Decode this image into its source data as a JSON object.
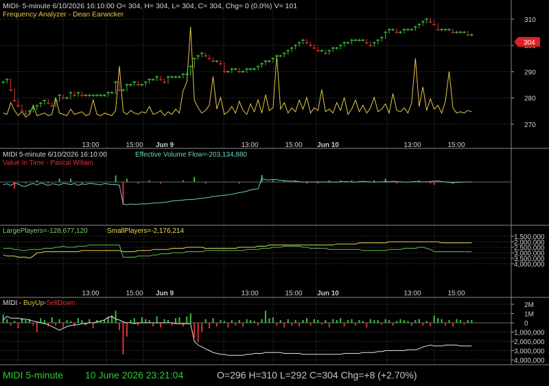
{
  "colors": {
    "background": "#000000",
    "grid": "#4a4a4a",
    "axis_text": "#d0d0d0",
    "up": "#3cc43c",
    "down": "#e03030",
    "yellow": "#e8c84a",
    "cyan": "#6fd0c8",
    "orange": "#d87020",
    "footer_green": "#2fd02f"
  },
  "panels": {
    "price": {
      "header": "MIDI- 5-minute 6/10/2026 16:10:00 O= 304, H= 304, L= 304, C= 304, Chg= 0 (0.0%) V= 101",
      "subtitle": "Frequency Analyzer - Dean Earwicker",
      "last_price_tag": "304"
    },
    "evf": {
      "header": "MIDI 5-minute  6/10/2026 16:10:00",
      "indicator": "Effective Volume Flow=-203,134,880",
      "subtitle": "Value In Time - Pascal Willain"
    },
    "players": {
      "large_label": "LargePlayers=-128,677,120",
      "small_label": "SmallPlayers=-2,176,214"
    },
    "buyup": {
      "prefix": "MIDI - ",
      "buy": "BuyUp",
      "sep": "-",
      "sell": "SellDown"
    }
  },
  "x_axis": {
    "labels": [
      {
        "text": "13:00",
        "bold": false
      },
      {
        "text": "15:00",
        "bold": false
      },
      {
        "text": "Jun 9",
        "bold": true
      },
      {
        "text": "13:00",
        "bold": false
      },
      {
        "text": "15:00",
        "bold": false
      },
      {
        "text": "Jun 10",
        "bold": true
      },
      {
        "text": "13:00",
        "bold": false
      },
      {
        "text": "15:00",
        "bold": false
      }
    ]
  },
  "footer": {
    "symbol": "MIDI  5-minute",
    "date": "10 June 2026 23:21:04",
    "ohlc": "O=296  H=310  L=292  C=304  Chg=+8 (+2.70%)"
  },
  "chart_data": [
    {
      "type": "line",
      "title": "MIDI- 5-minute",
      "y_axis_ticks": [
        270,
        280,
        290,
        300,
        310
      ],
      "ylim": [
        265,
        316
      ],
      "series": [
        {
          "name": "MIDI price",
          "values": [
            286,
            287,
            283,
            279,
            277,
            275,
            274,
            275,
            276,
            277,
            278,
            279,
            278,
            277,
            279,
            281,
            280,
            280,
            282,
            281,
            282,
            281,
            281,
            281,
            281,
            281,
            281,
            281,
            282,
            282,
            286,
            283,
            283,
            285,
            285,
            286,
            285,
            285,
            286,
            287,
            287,
            288,
            287,
            286,
            288,
            288,
            288,
            288,
            289,
            289,
            292,
            295,
            296,
            297,
            296,
            295,
            294,
            294,
            293,
            290,
            290,
            291,
            291,
            290,
            290,
            291,
            291,
            291,
            292,
            293,
            294,
            294,
            295,
            296,
            296,
            297,
            298,
            299,
            300,
            301,
            302,
            301,
            300,
            299,
            298,
            298,
            297,
            298,
            299,
            299,
            300,
            301,
            301,
            302,
            302,
            302,
            302,
            301,
            300,
            301,
            302,
            303,
            305,
            306,
            306,
            305,
            305,
            306,
            306,
            306,
            307,
            308,
            309,
            310,
            309,
            308,
            306,
            306,
            306,
            306,
            305,
            305,
            305,
            305,
            304,
            304
          ]
        }
      ]
    },
    {
      "type": "line",
      "title": "Frequency Analyzer - Dean Earwicker",
      "series": [
        {
          "name": "Frequency Analyzer",
          "values": [
            0.6,
            0.5,
            1.4,
            0.8,
            0.4,
            0.7,
            0.3,
            0.5,
            1.2,
            0.4,
            0.5,
            0.6,
            0.4,
            0.5,
            1.8,
            0.6,
            0.5,
            0.4,
            0.9,
            0.5,
            0.6,
            0.7,
            0.4,
            0.5,
            1.6,
            0.5,
            0.4,
            0.6,
            0.5,
            0.4,
            0.8,
            4.2,
            0.7,
            0.5,
            0.8,
            0.6,
            0.5,
            0.7,
            0.6,
            1.1,
            0.5,
            0.6,
            0.8,
            0.4,
            0.7,
            0.5,
            0.9,
            0.6,
            2.3,
            3.0,
            7.2,
            1.6,
            1.0,
            0.6,
            0.8,
            1.2,
            3.4,
            0.9,
            1.8,
            0.5,
            0.7,
            1.1,
            0.6,
            1.5,
            0.8,
            0.5,
            1.3,
            0.7,
            1.6,
            0.6,
            2.0,
            0.8,
            1.0,
            5.0,
            0.9,
            1.4,
            0.6,
            1.0,
            0.7,
            1.6,
            0.9,
            1.8,
            0.6,
            1.0,
            0.8,
            2.4,
            0.7,
            0.9,
            0.6,
            1.4,
            0.8,
            1.8,
            0.5,
            0.9,
            1.6,
            0.7,
            1.2,
            0.6,
            1.0,
            1.8,
            0.7,
            0.9,
            1.3,
            0.6,
            2.1,
            0.8,
            0.7,
            1.0,
            0.6,
            1.4,
            4.8,
            1.1,
            2.6,
            0.8,
            1.7,
            0.9,
            1.2,
            0.6,
            1.5,
            3.8,
            1.0,
            0.6,
            0.7,
            0.6,
            0.8,
            0.7
          ]
        }
      ]
    },
    {
      "type": "bar",
      "title": "Effective Volume Flow",
      "series": [
        {
          "name": "Effective Volume Flow",
          "values": [
            -1.2,
            -0.8,
            -1.5,
            -0.6,
            -0.9,
            -1.8,
            -2.0,
            -1.1,
            -0.7,
            -1.3,
            -0.5,
            -0.9,
            -1.6,
            -0.8,
            -1.0,
            -1.4,
            -0.6,
            -0.8,
            -1.2,
            -0.7,
            -1.5,
            -0.9,
            -1.1,
            -0.6,
            -0.8,
            -1.0,
            -1.3,
            -0.7,
            -0.9,
            -1.2,
            -1.1,
            -1.4,
            -10.1,
            -10.3,
            -10.0,
            -10.2,
            -10.1,
            -9.9,
            -10.0,
            -9.8,
            -9.6,
            -9.5,
            -9.4,
            -9.3,
            -9.0,
            -8.7,
            -8.5,
            -8.4,
            -8.2,
            -8.0,
            -8.0,
            -7.9,
            -7.6,
            -7.4,
            -7.2,
            -7.0,
            -6.6,
            -6.4,
            -6.2,
            -6.0,
            -5.8,
            -5.6,
            -5.2,
            -4.8,
            -4.6,
            -4.2,
            -3.6,
            -3.3,
            -3.1,
            1.6,
            1.0,
            0.9,
            1.2,
            1.0,
            0.8,
            0.6,
            0.5,
            0.3,
            0.4,
            0.2,
            -0.1,
            0.1,
            0.0,
            -0.1,
            0.1,
            0.0,
            0.1,
            -0.1,
            0.0,
            -0.1,
            0.1,
            0.2,
            0.1,
            0.0,
            -0.1,
            0.2,
            0.3,
            0.2,
            0.1,
            -0.1,
            0.0,
            0.1,
            0.2,
            0.1,
            0.3,
            0.2,
            0.1,
            0.0,
            -0.1,
            0.1,
            0.2,
            0.1,
            0.0,
            0.1,
            0.2,
            0.4,
            0.5,
            0.2,
            0.0,
            -0.2,
            -0.4,
            -0.2,
            -0.1,
            0.0,
            0.0,
            0.0
          ]
        }
      ]
    },
    {
      "type": "line",
      "title": "LargePlayers / SmallPlayers",
      "y_axis_ticks": [
        "1,500,000",
        "2,000,000",
        "2,500,000",
        "3,000,000",
        "3,500,000",
        "4,000,000"
      ],
      "series": [
        {
          "name": "LargePlayers",
          "values": [
            2.6,
            2.6,
            2.6,
            2.7,
            2.7,
            2.8,
            2.8,
            2.7,
            2.7,
            2.7,
            2.7,
            2.6,
            2.6,
            2.6,
            2.5,
            2.5,
            2.4,
            2.5,
            2.5,
            2.5,
            2.4,
            2.4,
            2.4,
            2.3,
            2.3,
            2.3,
            2.3,
            2.3,
            2.3,
            2.3,
            2.3,
            2.3,
            3.4,
            3.4,
            3.4,
            3.4,
            3.3,
            3.3,
            3.3,
            3.3,
            3.2,
            3.2,
            3.1,
            3.1,
            3.1,
            3.0,
            3.0,
            3.0,
            3.0,
            2.9,
            2.9,
            2.9,
            2.9,
            2.9,
            2.8,
            2.8,
            2.8,
            2.8,
            2.8,
            2.8,
            2.8,
            2.8,
            2.8,
            2.8,
            2.8,
            2.7,
            2.7,
            2.7,
            2.7,
            2.6,
            2.6,
            2.6,
            2.5,
            2.5,
            2.5,
            2.4,
            2.4,
            2.4,
            2.4,
            2.4,
            2.5,
            2.5,
            2.6,
            2.6,
            2.6,
            2.6,
            2.6,
            2.7,
            2.7,
            2.7,
            2.7,
            2.7,
            2.7,
            2.7,
            2.7,
            2.7,
            2.8,
            2.8,
            2.8,
            2.8,
            2.8,
            2.8,
            2.8,
            2.7,
            2.7,
            2.7,
            2.7,
            2.6,
            2.6,
            2.6,
            2.6,
            2.5,
            2.5,
            2.6,
            2.7,
            2.9,
            2.9,
            2.9,
            2.9,
            2.9,
            2.9,
            2.9,
            2.9,
            2.9,
            2.9,
            2.9
          ]
        },
        {
          "name": "SmallPlayers",
          "values": [
            3.2,
            3.3,
            3.3,
            3.3,
            3.4,
            3.4,
            3.4,
            3.5,
            3.3,
            3.0,
            3.0,
            2.9,
            2.9,
            2.9,
            2.9,
            2.9,
            2.9,
            2.9,
            2.9,
            2.9,
            2.9,
            2.8,
            2.8,
            2.8,
            2.8,
            2.8,
            2.8,
            2.8,
            2.8,
            2.8,
            2.8,
            2.8,
            2.9,
            2.9,
            2.9,
            2.9,
            2.8,
            2.8,
            2.8,
            2.8,
            2.7,
            2.7,
            2.7,
            2.7,
            2.7,
            2.6,
            2.6,
            2.6,
            2.6,
            2.5,
            2.5,
            2.5,
            2.5,
            2.5,
            2.6,
            2.6,
            2.6,
            2.6,
            2.6,
            2.6,
            2.6,
            2.6,
            2.6,
            2.5,
            2.5,
            2.5,
            2.5,
            2.5,
            2.4,
            2.4,
            2.4,
            2.3,
            2.3,
            2.3,
            2.3,
            2.3,
            2.3,
            2.3,
            2.3,
            2.3,
            2.3,
            2.3,
            2.3,
            2.3,
            2.3,
            2.3,
            2.3,
            2.3,
            2.3,
            2.2,
            2.2,
            2.2,
            2.2,
            2.2,
            2.2,
            2.1,
            2.1,
            2.1,
            2.1,
            2.1,
            2.1,
            2.1,
            2.1,
            2.0,
            2.0,
            2.0,
            2.0,
            2.0,
            2.0,
            2.0,
            2.0,
            2.0,
            2.0,
            2.0,
            2.0,
            2.0,
            2.0,
            2.1,
            2.1,
            2.1,
            2.1,
            2.1,
            2.1,
            2.1,
            2.1,
            2.1
          ]
        }
      ]
    },
    {
      "type": "bar",
      "title": "MIDI - BuyUp-SellDown",
      "y_axis_ticks": [
        "2M",
        "1M",
        "0",
        "1,000,000",
        "2,000,000",
        "3,000,000",
        "4,000,000"
      ],
      "series": [
        {
          "name": "BuyUp-SellDown bars",
          "values": [
            0.9,
            0.4,
            -0.3,
            0.2,
            -0.6,
            0.5,
            0.3,
            0.4,
            -0.3,
            -1.0,
            0.5,
            0.3,
            -0.4,
            0.6,
            -0.3,
            0.4,
            -0.5,
            0.3,
            0.2,
            -0.4,
            0.5,
            0.3,
            -0.3,
            0.4,
            -0.6,
            0.3,
            0.2,
            0.3,
            0.6,
            0.8,
            1.3,
            -0.8,
            -3.4,
            -1.5,
            0.3,
            0.5,
            -0.3,
            0.6,
            0.4,
            0.3,
            -0.4,
            0.7,
            -0.5,
            0.4,
            0.3,
            -0.3,
            0.5,
            0.6,
            -0.4,
            0.7,
            1.0,
            -1.6,
            -2.1,
            -1.0,
            0.4,
            -0.6,
            0.5,
            -0.4,
            0.3,
            0.2,
            -0.5,
            0.3,
            -0.3,
            0.3,
            -0.4,
            0.4,
            0.3,
            0.2,
            -0.3,
            0.4,
            1.3,
            0.5,
            0.6,
            -0.3,
            0.3,
            -0.5,
            0.4,
            -0.3,
            0.3,
            -0.4,
            0.3,
            0.5,
            -0.3,
            0.4,
            0.3,
            -0.2,
            0.3,
            -0.5,
            0.4,
            0.3,
            0.5,
            -0.4,
            0.3,
            0.4,
            -0.3,
            0.3,
            0.2,
            -0.5,
            0.4,
            0.3,
            0.3,
            -0.2,
            0.4,
            0.3,
            -0.3,
            0.2,
            0.4,
            0.3,
            0.2,
            -0.3,
            0.3,
            0.4,
            -0.3,
            0.2,
            -0.4,
            0.8,
            0.5,
            0.4,
            -0.3,
            0.3,
            -0.4,
            0.4,
            0.3,
            -0.2,
            0.3,
            0.3
          ]
        },
        {
          "name": "BuyUp-SellDown line",
          "values": [
            0.3,
            0.7,
            0.5,
            0.5,
            0.5,
            0.4,
            0.4,
            0.3,
            0.2,
            0.1,
            0.0,
            -0.1,
            -0.2,
            -0.4,
            -0.6,
            -0.8,
            -0.6,
            -0.4,
            -0.3,
            -0.2,
            -0.2,
            -0.1,
            -0.1,
            0.0,
            0.0,
            0.1,
            0.2,
            0.3,
            0.6,
            0.7,
            0.4,
            0.3,
            0.1,
            0.0,
            0.0,
            -0.1,
            0.0,
            0.0,
            0.0,
            0.0,
            0.0,
            0.0,
            0.0,
            0.0,
            0.0,
            0.0,
            -0.1,
            -0.1,
            -0.1,
            -0.1,
            -0.1,
            -2.0,
            -2.4,
            -2.6,
            -2.8,
            -3.0,
            -3.2,
            -3.3,
            -3.4,
            -3.4,
            -3.5,
            -3.5,
            -3.5,
            -3.5,
            -3.5,
            -3.4,
            -3.4,
            -3.3,
            -3.3,
            -3.3,
            -3.2,
            -3.2,
            -3.2,
            -3.2,
            -3.2,
            -3.3,
            -3.3,
            -3.3,
            -3.3,
            -3.3,
            -3.4,
            -3.4,
            -3.4,
            -3.4,
            -3.4,
            -3.4,
            -3.4,
            -3.4,
            -3.4,
            -3.4,
            -3.4,
            -3.3,
            -3.3,
            -3.3,
            -3.3,
            -3.3,
            -3.2,
            -3.2,
            -3.2,
            -3.2,
            -3.1,
            -3.1,
            -3.0,
            -3.0,
            -3.0,
            -3.0,
            -3.0,
            -3.0,
            -2.9,
            -2.9,
            -2.9,
            -2.8,
            -2.6,
            -2.5,
            -2.4,
            -2.5,
            -2.5,
            -2.5,
            -2.4,
            -2.4,
            -2.4,
            -2.4,
            -2.5,
            -2.5,
            -2.5,
            -2.5
          ]
        }
      ]
    }
  ]
}
